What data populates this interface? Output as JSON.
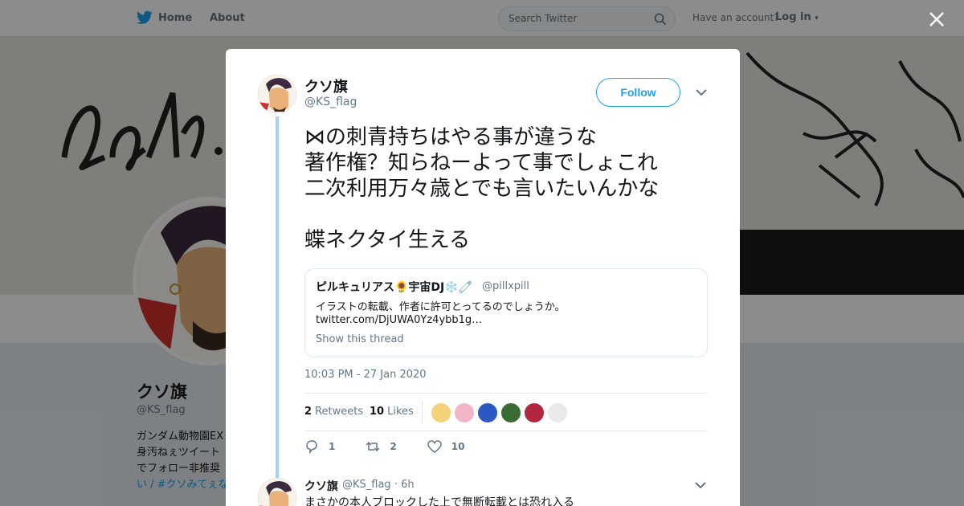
{
  "nav": {
    "home_label": "Home",
    "about_label": "About",
    "search_placeholder": "Search Twitter",
    "have_account": "Have an account?",
    "login_label": "Log in"
  },
  "profile": {
    "name": "クソ旗",
    "handle": "@KS_flag",
    "bio_lines": [
      "ガンダム動物園EX",
      "身汚ねぇツイート",
      "でフォロー非推奨"
    ],
    "bio_link": "い / #クソみてぇな"
  },
  "tweet": {
    "author_name": "クソ旗",
    "author_handle": "@KS_flag",
    "follow_label": "Follow",
    "text": "⋈の刺青持ちはやる事が違うな\n著作権？知らねーよって事でしょこれ\n二次利用万々歳とでも言いたいんかな\n\n蝶ネクタイ生える",
    "quote": {
      "name": "ピルキュリアス🌻宇宙DJ❄️🧷",
      "handle": "@pillxpill",
      "text": "イラストの転載、作者に許可とってるのでしょうか。",
      "link": "twitter.com/DjUWA0Yz4ybb1g…",
      "show_thread": "Show this thread"
    },
    "timestamp": "10:03 PM - 27 Jan 2020",
    "retweets_count": "2",
    "retweets_label": "Retweets",
    "likes_count": "10",
    "likes_label": "Likes",
    "likers_colors": [
      "#f3d27a",
      "#f2b6c6",
      "#2b59c3",
      "#3a6b35",
      "#b3263f",
      "#e9e9e9"
    ],
    "reply_count": "1",
    "retweet_action_count": "2",
    "like_action_count": "10"
  },
  "reply": {
    "name": "クソ旗",
    "handle_time": "@KS_flag · 6h",
    "text": "まさかの本人ブロックした上で無断転載とは恐れ入る"
  },
  "colors": {
    "accent": "#1da1f2",
    "thread_line": "#a3d2f5",
    "muted": "#657786"
  }
}
